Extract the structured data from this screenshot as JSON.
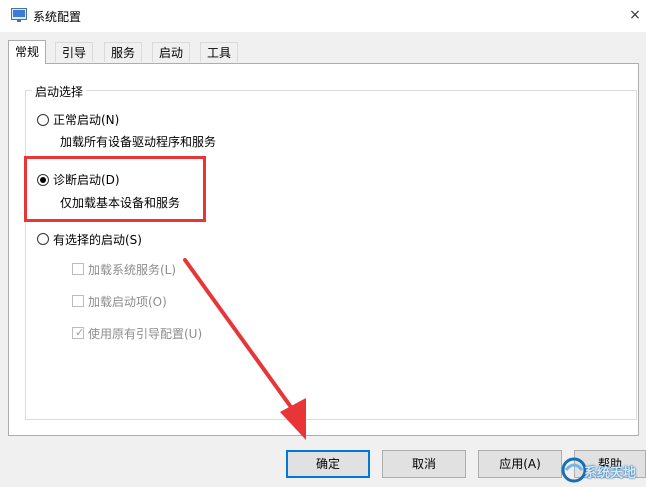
{
  "window": {
    "title": "系统配置",
    "close_glyph": "×"
  },
  "tabs": [
    {
      "label": "常规",
      "active": true
    },
    {
      "label": "引导",
      "active": false
    },
    {
      "label": "服务",
      "active": false
    },
    {
      "label": "启动",
      "active": false
    },
    {
      "label": "工具",
      "active": false
    }
  ],
  "startup_group": {
    "legend": "启动选择",
    "options": [
      {
        "label": "正常启动(N)",
        "description": "加载所有设备驱动程序和服务",
        "selected": false
      },
      {
        "label": "诊断启动(D)",
        "description": "仅加载基本设备和服务",
        "selected": true
      },
      {
        "label": "有选择的启动(S)",
        "description": "",
        "selected": false
      }
    ],
    "selective_items": [
      {
        "label": "加载系统服务(L)",
        "checked": false,
        "enabled": false
      },
      {
        "label": "加载启动项(O)",
        "checked": false,
        "enabled": false
      },
      {
        "label": "使用原有引导配置(U)",
        "checked": true,
        "enabled": false
      }
    ]
  },
  "buttons": {
    "ok": "确定",
    "cancel": "取消",
    "apply": "应用(A)",
    "help": "帮助"
  },
  "watermark": {
    "text": "系统天地"
  },
  "colors": {
    "annotation": "#e83537",
    "default_button_border": "#0078d7",
    "dialog_bg": "#f0f0f0"
  }
}
